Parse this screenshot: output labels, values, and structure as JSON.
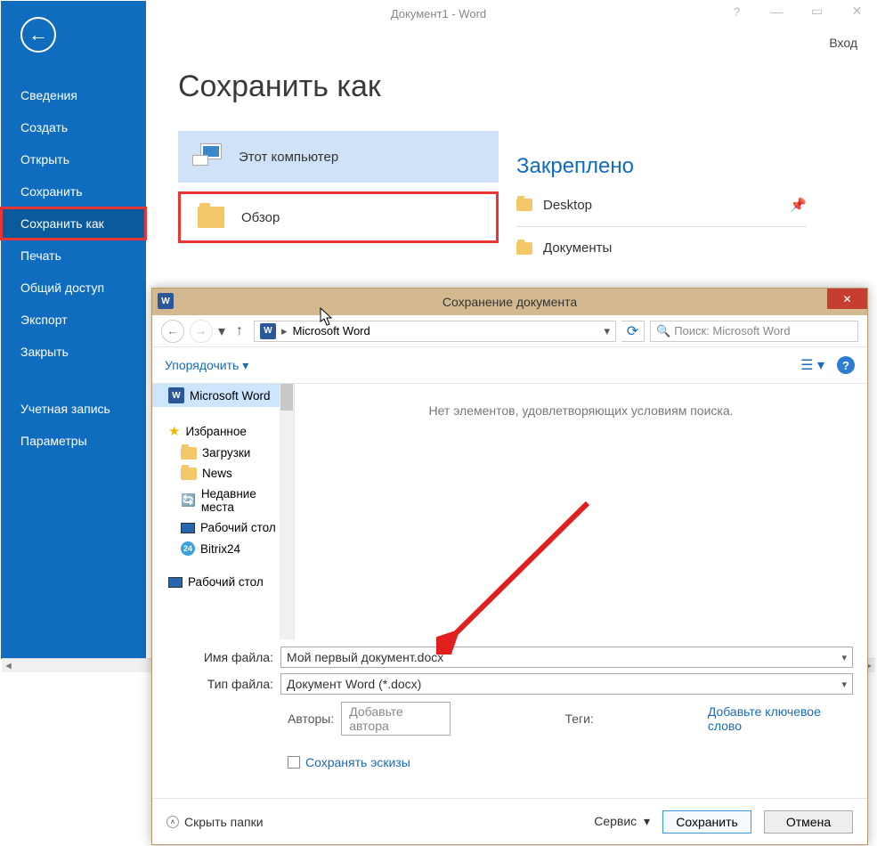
{
  "titlebar": {
    "title": "Документ1 - Word",
    "login": "Вход"
  },
  "sidebar": {
    "items": [
      {
        "label": "Сведения"
      },
      {
        "label": "Создать"
      },
      {
        "label": "Открыть"
      },
      {
        "label": "Сохранить"
      },
      {
        "label": "Сохранить как"
      },
      {
        "label": "Печать"
      },
      {
        "label": "Общий доступ"
      },
      {
        "label": "Экспорт"
      },
      {
        "label": "Закрыть"
      }
    ],
    "account": "Учетная запись",
    "options": "Параметры"
  },
  "page": {
    "title": "Сохранить как"
  },
  "save_options": {
    "this_pc": "Этот компьютер",
    "browse": "Обзор"
  },
  "pinned": {
    "title": "Закреплено",
    "items": [
      {
        "label": "Desktop"
      },
      {
        "label": "Документы"
      }
    ]
  },
  "dialog": {
    "title": "Сохранение документа",
    "breadcrumb": "Microsoft Word",
    "search_placeholder": "Поиск: Microsoft Word",
    "organize": "Упорядочить",
    "empty": "Нет элементов, удовлетворяющих условиям поиска.",
    "tree": {
      "current": "Microsoft Word",
      "favorites": "Избранное",
      "fav_items": [
        {
          "label": "Загрузки"
        },
        {
          "label": "News"
        },
        {
          "label": "Недавние места"
        },
        {
          "label": "Рабочий стол"
        },
        {
          "label": "Bitrix24"
        }
      ],
      "desktop": "Рабочий стол"
    },
    "filename_label": "Имя файла:",
    "filename_value": "Мой первый документ.docx",
    "filetype_label": "Тип файла:",
    "filetype_value": "Документ Word (*.docx)",
    "authors_label": "Авторы:",
    "authors_placeholder": "Добавьте автора",
    "tags_label": "Теги:",
    "tags_placeholder": "Добавьте ключевое слово",
    "save_thumbs": "Сохранять эскизы",
    "hide_folders": "Скрыть папки",
    "service": "Сервис",
    "save_btn": "Сохранить",
    "cancel_btn": "Отмена"
  }
}
